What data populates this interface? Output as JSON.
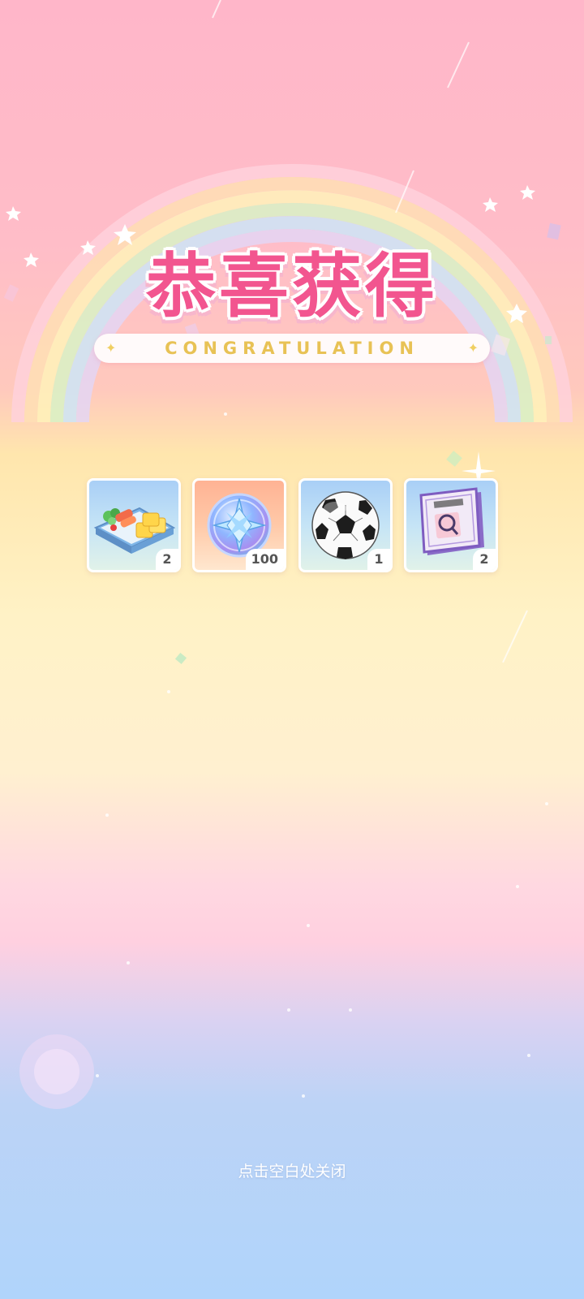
{
  "popup": {
    "title": "恭喜获得",
    "subtitle": "CONGRATULATION",
    "close_hint": "点击空白处关闭"
  },
  "rewards": [
    {
      "name": "bento-box",
      "quantity": "2",
      "bg": "blue"
    },
    {
      "name": "star-coin",
      "quantity": "100",
      "bg": "orange"
    },
    {
      "name": "soccer-ball",
      "quantity": "1",
      "bg": "blue"
    },
    {
      "name": "magnifier-book",
      "quantity": "2",
      "bg": "blue"
    }
  ],
  "colors": {
    "title": "#f2558f",
    "subtitle": "#e8c255",
    "rainbow": [
      "#ffd2dc",
      "#ffe0b5",
      "#fff3ba",
      "#d9f3c6",
      "#cde6f7",
      "#e4d6f5"
    ]
  }
}
